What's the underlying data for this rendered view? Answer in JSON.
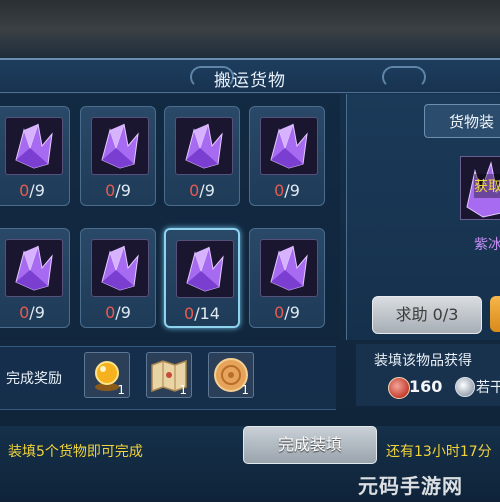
{
  "window": {
    "title": "搬运货物"
  },
  "slots": [
    {
      "count_have": "0",
      "count_sep": "/",
      "count_need": "9",
      "selected": false,
      "icon": "purple-crystal-icon"
    },
    {
      "count_have": "0",
      "count_sep": "/",
      "count_need": "9",
      "selected": false,
      "icon": "purple-crystal-icon"
    },
    {
      "count_have": "0",
      "count_sep": "/",
      "count_need": "9",
      "selected": false,
      "icon": "purple-crystal-icon"
    },
    {
      "count_have": "0",
      "count_sep": "/",
      "count_need": "9",
      "selected": false,
      "icon": "purple-crystal-icon"
    },
    {
      "count_have": "0",
      "count_sep": "/",
      "count_need": "9",
      "selected": false,
      "icon": "purple-crystal-icon"
    },
    {
      "count_have": "0",
      "count_sep": "/",
      "count_need": "9",
      "selected": false,
      "icon": "purple-crystal-icon"
    },
    {
      "count_have": "0",
      "count_sep": "/",
      "count_need": "14",
      "selected": true,
      "icon": "purple-crystal-icon"
    },
    {
      "count_have": "0",
      "count_sep": "/",
      "count_need": "9",
      "selected": false,
      "icon": "purple-crystal-icon"
    }
  ],
  "rewards": {
    "label": "完成奖励",
    "items": [
      {
        "icon": "golden-orb-icon",
        "qty": "1"
      },
      {
        "icon": "treasure-map-icon",
        "qty": "1"
      },
      {
        "icon": "mooncake-icon",
        "qty": "1"
      }
    ]
  },
  "right_panel": {
    "tab_label": "货物装",
    "item_label": "获取",
    "item_name": "紫冰",
    "help_button": "求助 0/3",
    "gain_label": "装填该物品获得",
    "gain_value": "160",
    "gain_extra": "若干"
  },
  "footer": {
    "hint": "装填5个货物即可完成",
    "complete_button": "完成装填",
    "time_left": "还有13小时17分"
  },
  "watermark": "元码手游网",
  "colors": {
    "accent_yellow": "#f1d33b",
    "count_red": "#e85b4f",
    "crystal_purple": "#a66bf0",
    "panel_blue": "#16314d"
  }
}
